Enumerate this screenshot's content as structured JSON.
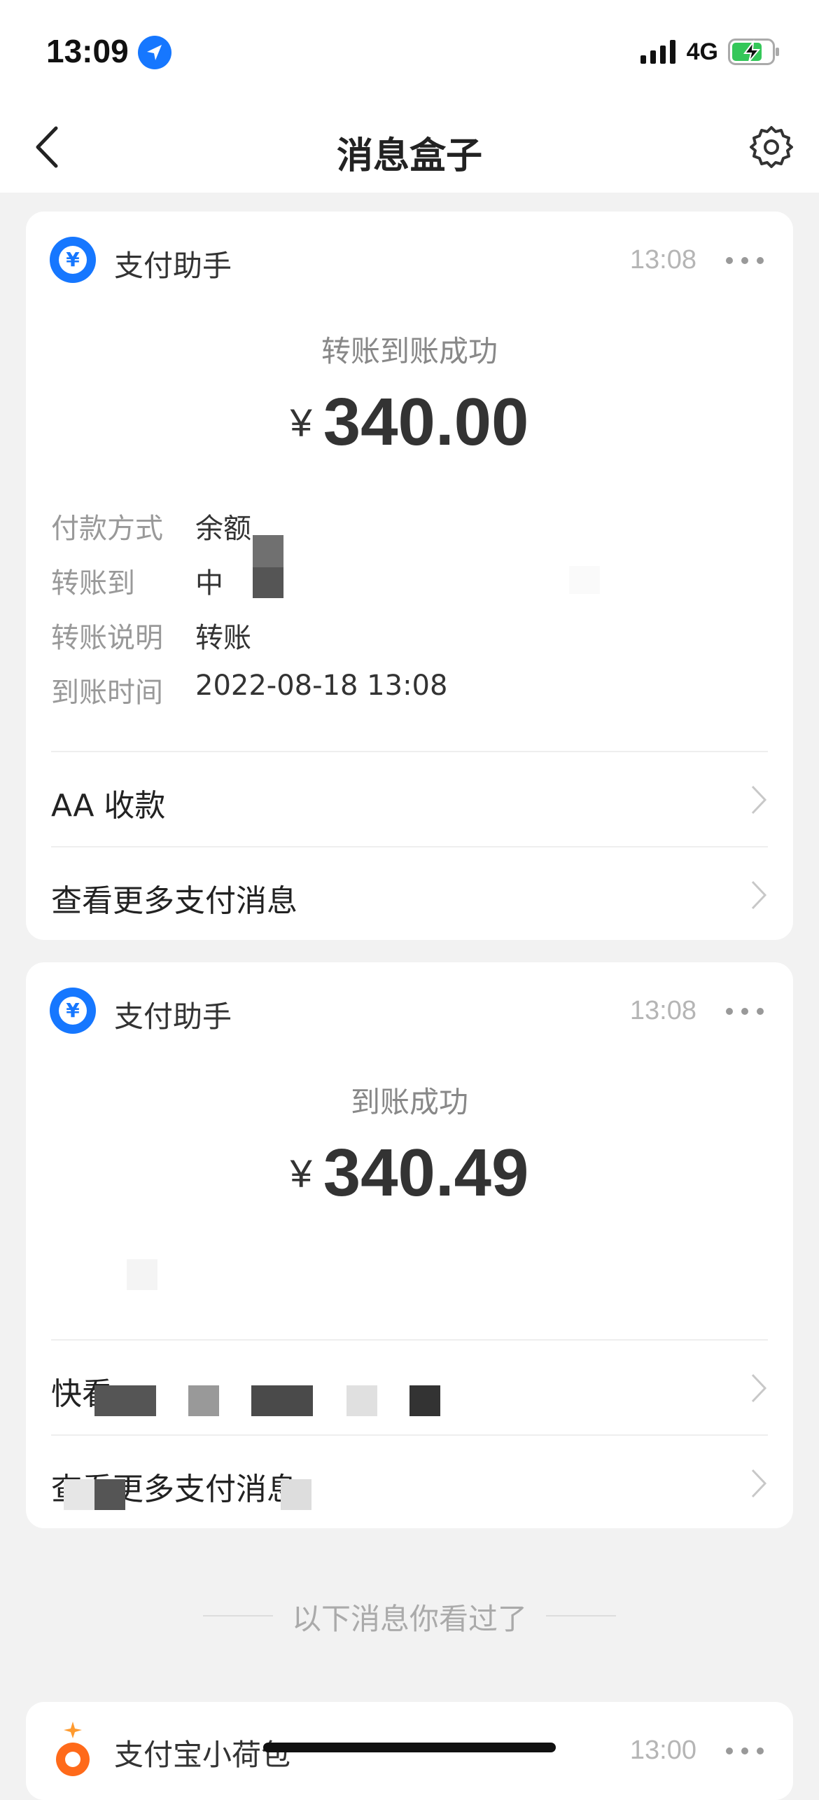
{
  "status_bar": {
    "time": "13:09",
    "network": "4G"
  },
  "nav": {
    "title": "消息盒子"
  },
  "cards": [
    {
      "app_name": "支付助手",
      "time": "13:08",
      "subtitle": "转账到账成功",
      "currency": "¥",
      "amount": "340.00",
      "details": [
        {
          "label": "付款方式",
          "value": "余额"
        },
        {
          "label": "转账到",
          "value": "中"
        },
        {
          "label": "转账说明",
          "value": "转账"
        },
        {
          "label": "到账时间",
          "value": "2022-08-18 13:08"
        }
      ],
      "links": [
        "AA 收款",
        "查看更多支付消息"
      ]
    },
    {
      "app_name": "支付助手",
      "time": "13:08",
      "subtitle": "到账成功",
      "currency": "¥",
      "amount": "340.49",
      "links": [
        "快看",
        "查看更多支付消息"
      ]
    }
  ],
  "separator": "以下消息你看过了",
  "card3": {
    "app_name": "支付宝小荷包",
    "time": "13:00"
  },
  "colors": {
    "accent": "#1677ff",
    "card3_icon": "#ff6a1a"
  }
}
